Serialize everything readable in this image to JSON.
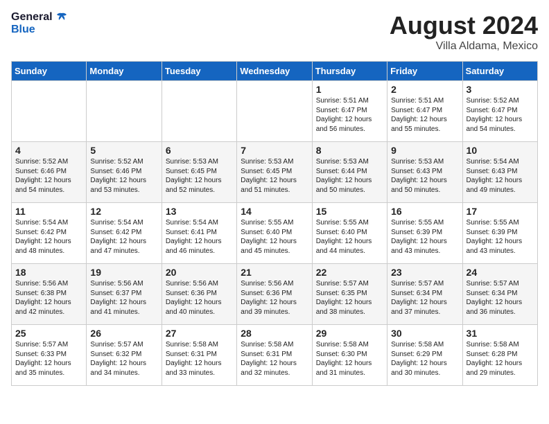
{
  "logo": {
    "line1": "General",
    "line2": "Blue"
  },
  "title": "August 2024",
  "subtitle": "Villa Aldama, Mexico",
  "days_of_week": [
    "Sunday",
    "Monday",
    "Tuesday",
    "Wednesday",
    "Thursday",
    "Friday",
    "Saturday"
  ],
  "weeks": [
    [
      {
        "day": "",
        "info": ""
      },
      {
        "day": "",
        "info": ""
      },
      {
        "day": "",
        "info": ""
      },
      {
        "day": "",
        "info": ""
      },
      {
        "day": "1",
        "info": "Sunrise: 5:51 AM\nSunset: 6:47 PM\nDaylight: 12 hours\nand 56 minutes."
      },
      {
        "day": "2",
        "info": "Sunrise: 5:51 AM\nSunset: 6:47 PM\nDaylight: 12 hours\nand 55 minutes."
      },
      {
        "day": "3",
        "info": "Sunrise: 5:52 AM\nSunset: 6:47 PM\nDaylight: 12 hours\nand 54 minutes."
      }
    ],
    [
      {
        "day": "4",
        "info": "Sunrise: 5:52 AM\nSunset: 6:46 PM\nDaylight: 12 hours\nand 54 minutes."
      },
      {
        "day": "5",
        "info": "Sunrise: 5:52 AM\nSunset: 6:46 PM\nDaylight: 12 hours\nand 53 minutes."
      },
      {
        "day": "6",
        "info": "Sunrise: 5:53 AM\nSunset: 6:45 PM\nDaylight: 12 hours\nand 52 minutes."
      },
      {
        "day": "7",
        "info": "Sunrise: 5:53 AM\nSunset: 6:45 PM\nDaylight: 12 hours\nand 51 minutes."
      },
      {
        "day": "8",
        "info": "Sunrise: 5:53 AM\nSunset: 6:44 PM\nDaylight: 12 hours\nand 50 minutes."
      },
      {
        "day": "9",
        "info": "Sunrise: 5:53 AM\nSunset: 6:43 PM\nDaylight: 12 hours\nand 50 minutes."
      },
      {
        "day": "10",
        "info": "Sunrise: 5:54 AM\nSunset: 6:43 PM\nDaylight: 12 hours\nand 49 minutes."
      }
    ],
    [
      {
        "day": "11",
        "info": "Sunrise: 5:54 AM\nSunset: 6:42 PM\nDaylight: 12 hours\nand 48 minutes."
      },
      {
        "day": "12",
        "info": "Sunrise: 5:54 AM\nSunset: 6:42 PM\nDaylight: 12 hours\nand 47 minutes."
      },
      {
        "day": "13",
        "info": "Sunrise: 5:54 AM\nSunset: 6:41 PM\nDaylight: 12 hours\nand 46 minutes."
      },
      {
        "day": "14",
        "info": "Sunrise: 5:55 AM\nSunset: 6:40 PM\nDaylight: 12 hours\nand 45 minutes."
      },
      {
        "day": "15",
        "info": "Sunrise: 5:55 AM\nSunset: 6:40 PM\nDaylight: 12 hours\nand 44 minutes."
      },
      {
        "day": "16",
        "info": "Sunrise: 5:55 AM\nSunset: 6:39 PM\nDaylight: 12 hours\nand 43 minutes."
      },
      {
        "day": "17",
        "info": "Sunrise: 5:55 AM\nSunset: 6:39 PM\nDaylight: 12 hours\nand 43 minutes."
      }
    ],
    [
      {
        "day": "18",
        "info": "Sunrise: 5:56 AM\nSunset: 6:38 PM\nDaylight: 12 hours\nand 42 minutes."
      },
      {
        "day": "19",
        "info": "Sunrise: 5:56 AM\nSunset: 6:37 PM\nDaylight: 12 hours\nand 41 minutes."
      },
      {
        "day": "20",
        "info": "Sunrise: 5:56 AM\nSunset: 6:36 PM\nDaylight: 12 hours\nand 40 minutes."
      },
      {
        "day": "21",
        "info": "Sunrise: 5:56 AM\nSunset: 6:36 PM\nDaylight: 12 hours\nand 39 minutes."
      },
      {
        "day": "22",
        "info": "Sunrise: 5:57 AM\nSunset: 6:35 PM\nDaylight: 12 hours\nand 38 minutes."
      },
      {
        "day": "23",
        "info": "Sunrise: 5:57 AM\nSunset: 6:34 PM\nDaylight: 12 hours\nand 37 minutes."
      },
      {
        "day": "24",
        "info": "Sunrise: 5:57 AM\nSunset: 6:34 PM\nDaylight: 12 hours\nand 36 minutes."
      }
    ],
    [
      {
        "day": "25",
        "info": "Sunrise: 5:57 AM\nSunset: 6:33 PM\nDaylight: 12 hours\nand 35 minutes."
      },
      {
        "day": "26",
        "info": "Sunrise: 5:57 AM\nSunset: 6:32 PM\nDaylight: 12 hours\nand 34 minutes."
      },
      {
        "day": "27",
        "info": "Sunrise: 5:58 AM\nSunset: 6:31 PM\nDaylight: 12 hours\nand 33 minutes."
      },
      {
        "day": "28",
        "info": "Sunrise: 5:58 AM\nSunset: 6:31 PM\nDaylight: 12 hours\nand 32 minutes."
      },
      {
        "day": "29",
        "info": "Sunrise: 5:58 AM\nSunset: 6:30 PM\nDaylight: 12 hours\nand 31 minutes."
      },
      {
        "day": "30",
        "info": "Sunrise: 5:58 AM\nSunset: 6:29 PM\nDaylight: 12 hours\nand 30 minutes."
      },
      {
        "day": "31",
        "info": "Sunrise: 5:58 AM\nSunset: 6:28 PM\nDaylight: 12 hours\nand 29 minutes."
      }
    ]
  ]
}
